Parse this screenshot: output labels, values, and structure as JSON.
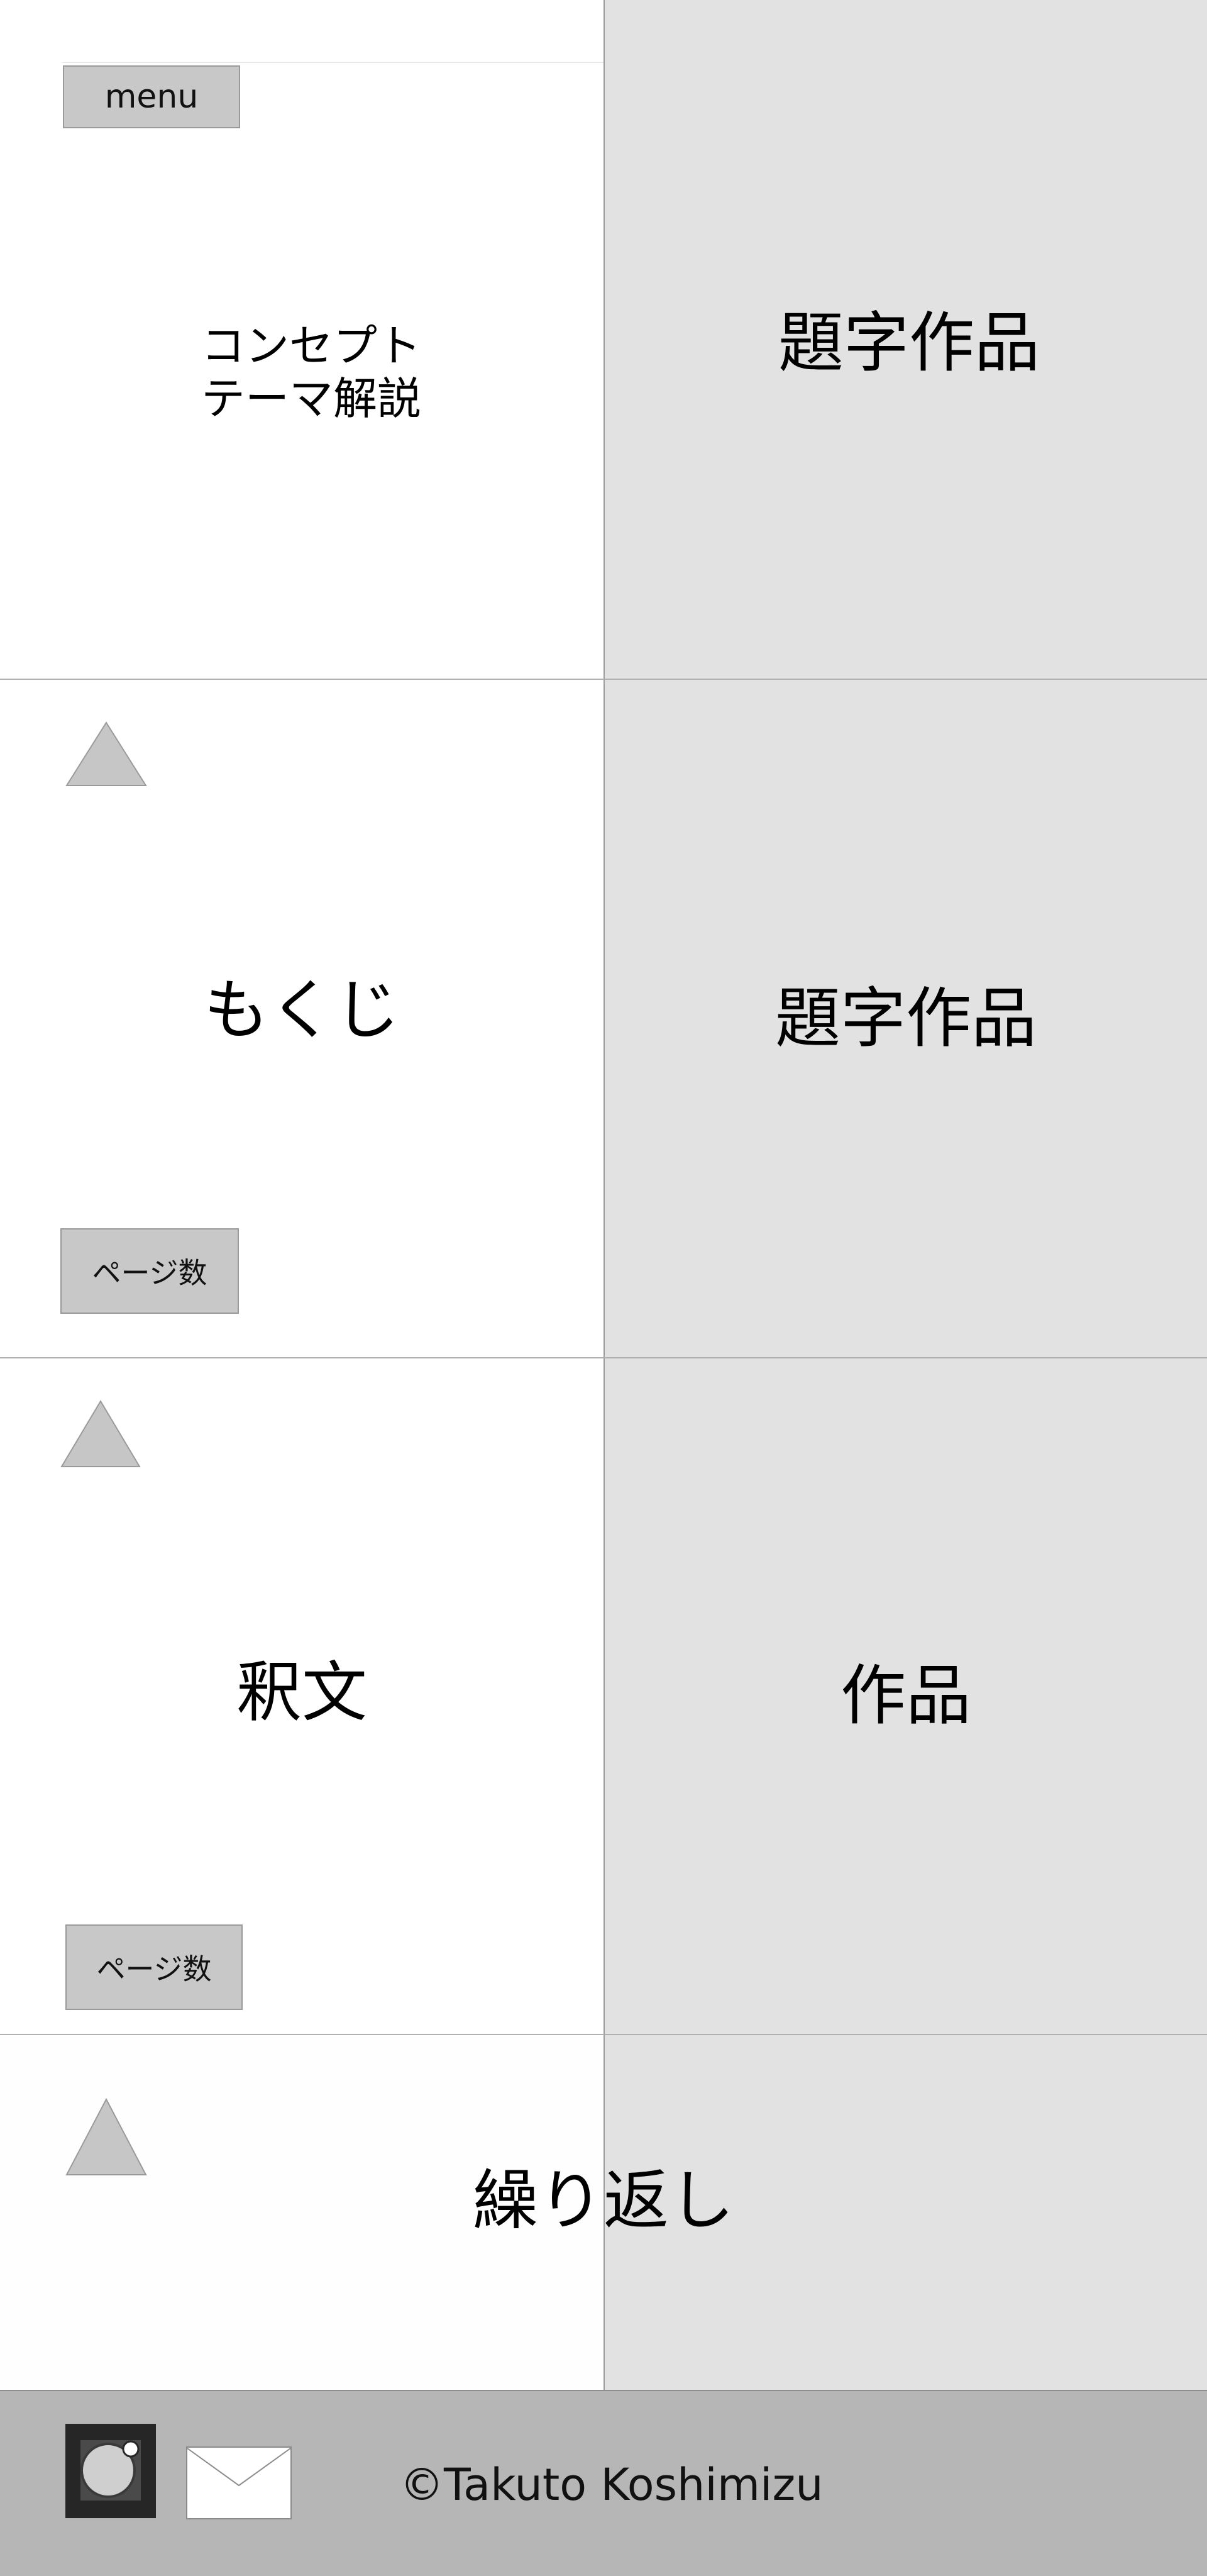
{
  "header": {
    "menu_label": "menu"
  },
  "section1": {
    "left_line1": "コンセプト",
    "left_line2": "テーマ解説",
    "right_title": "題字作品"
  },
  "section2": {
    "left_title": "もくじ",
    "right_title": "題字作品",
    "page_label": "ページ数"
  },
  "section3": {
    "left_title": "釈文",
    "right_title": "作品",
    "page_label": "ページ数"
  },
  "section4": {
    "center_title": "繰り返し"
  },
  "footer": {
    "copyright": "©Takuto Koshimizu",
    "icons": [
      "camera-icon",
      "mail-icon"
    ]
  },
  "colors": {
    "panel_gray": "#e2e2e2",
    "button_gray": "#c8c8c8",
    "footer_gray": "#b6b6b6"
  }
}
